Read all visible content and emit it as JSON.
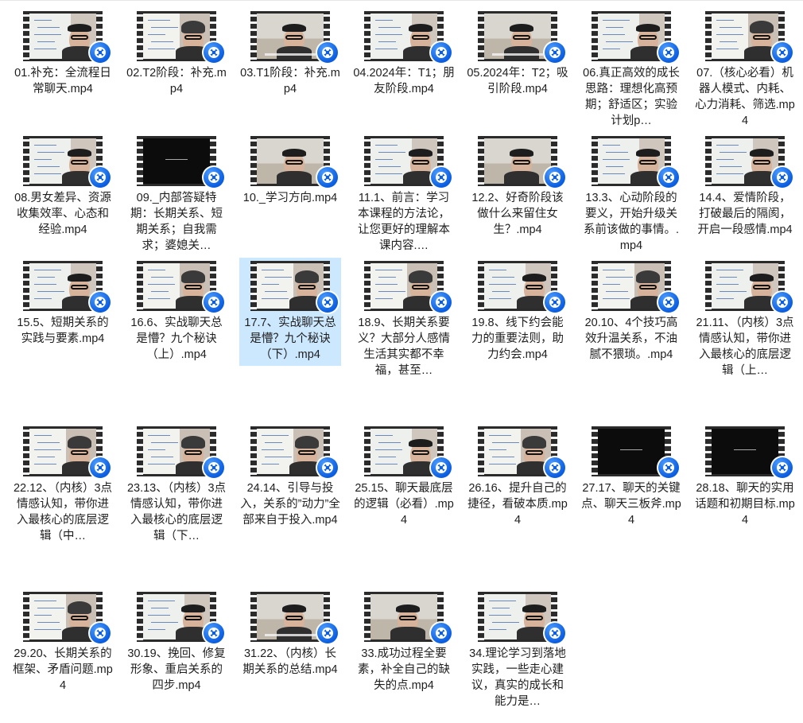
{
  "files": [
    {
      "label": "01.补充：全流程日常聊天.mp4",
      "thumb": "whiteboard-man",
      "selected": false
    },
    {
      "label": "02.T2阶段：补充.mp4",
      "thumb": "beanie-man",
      "selected": false
    },
    {
      "label": "03.T1阶段：补充.mp4",
      "thumb": "glasses-man",
      "selected": false
    },
    {
      "label": "04.2024年：T1；朋友阶段.mp4",
      "thumb": "whiteboard-man",
      "selected": false
    },
    {
      "label": "05.2024年：T2；吸引阶段.mp4",
      "thumb": "glasses-man",
      "selected": false
    },
    {
      "label": "06.真正高效的成长思路：理想化高预期；舒适区；实验计划p…",
      "thumb": "whiteboard-man",
      "selected": false
    },
    {
      "label": "07.（核心必看）机器人模式、内耗、心力消耗、筛选.mp4",
      "thumb": "beanie-man",
      "selected": false
    },
    {
      "label": "08.男女差异、资源收集效率、心态和经验.mp4",
      "thumb": "whiteboard-man",
      "selected": false
    },
    {
      "label": "09._内部答疑特期：长期关系、短期关系；自我需求；婆媳关…",
      "thumb": "dark",
      "selected": false
    },
    {
      "label": "10._学习方向.mp4",
      "thumb": "glasses-man",
      "selected": false
    },
    {
      "label": "11.1、前言：学习本课程的方法论，让您更好的理解本课内容.…",
      "thumb": "whiteboard-man",
      "selected": false
    },
    {
      "label": "12.2、好奇阶段该做什么来留住女生？.mp4",
      "thumb": "glasses-man",
      "selected": false
    },
    {
      "label": "13.3、心动阶段的要义，开始升级关系前该做的事情。.mp4",
      "thumb": "whiteboard-man",
      "selected": false
    },
    {
      "label": "14.4、爱情阶段，打破最后的隔阂，开启一段感情.mp4",
      "thumb": "whiteboard-man",
      "selected": false
    },
    {
      "label": "15.5、短期关系的实践与要素.mp4",
      "thumb": "whiteboard-man",
      "selected": false
    },
    {
      "label": "16.6、实战聊天总是懵？九个秘诀（上）.mp4",
      "thumb": "beanie-man",
      "selected": false
    },
    {
      "label": "17.7、实战聊天总是懵？九个秘诀（下）.mp4",
      "thumb": "beanie-man",
      "selected": true
    },
    {
      "label": "18.9、长期关系要义？大部分人感情生活其实都不幸福，甚至…",
      "thumb": "beanie-man",
      "selected": false
    },
    {
      "label": "19.8、线下约会能力的重要法则，助力约会.mp4",
      "thumb": "whiteboard-man",
      "selected": false
    },
    {
      "label": "20.10、4个技巧高效升温关系，不油腻不猥琐。.mp4",
      "thumb": "beanie-man",
      "selected": false
    },
    {
      "label": "21.11、（内核）3点情感认知，带你进入最核心的底层逻辑（上…",
      "thumb": "whiteboard-man",
      "selected": false
    },
    {
      "label": "22.12、（内核）3点情感认知，带你进入最核心的底层逻辑（中…",
      "thumb": "beanie-man",
      "selected": false
    },
    {
      "label": "23.13、（内核）3点情感认知，带你进入最核心的底层逻辑（下…",
      "thumb": "beanie-man",
      "selected": false
    },
    {
      "label": "24.14、引导与投入，关系的”动力”全部来自于投入.mp4",
      "thumb": "beanie-man",
      "selected": false
    },
    {
      "label": "25.15、聊天最底层的逻辑（必看）.mp4",
      "thumb": "whiteboard-man",
      "selected": false
    },
    {
      "label": "26.16、提升自己的捷径，看破本质.mp4",
      "thumb": "beanie-man",
      "selected": false
    },
    {
      "label": "27.17、聊天的关键点、聊天三板斧.mp4",
      "thumb": "dark",
      "selected": false
    },
    {
      "label": "28.18、聊天的实用话题和初期目标.mp4",
      "thumb": "dark",
      "selected": false
    },
    {
      "label": "29.20、长期关系的框架、矛盾问题.mp4",
      "thumb": "beanie-man",
      "selected": false
    },
    {
      "label": "30.19、挽回、修复形象、重启关系的四步.mp4",
      "thumb": "whiteboard-man",
      "selected": false
    },
    {
      "label": "31.22、（内核）长期关系的总结.mp4",
      "thumb": "glasses-man",
      "selected": false
    },
    {
      "label": "33.成功过程全要素，补全自己的缺失的点.mp4",
      "thumb": "glasses-man",
      "selected": false
    },
    {
      "label": "34.理论学习到落地实践，一些走心建议，真实的成长和能力是…",
      "thumb": "whiteboard-man",
      "selected": false
    }
  ]
}
